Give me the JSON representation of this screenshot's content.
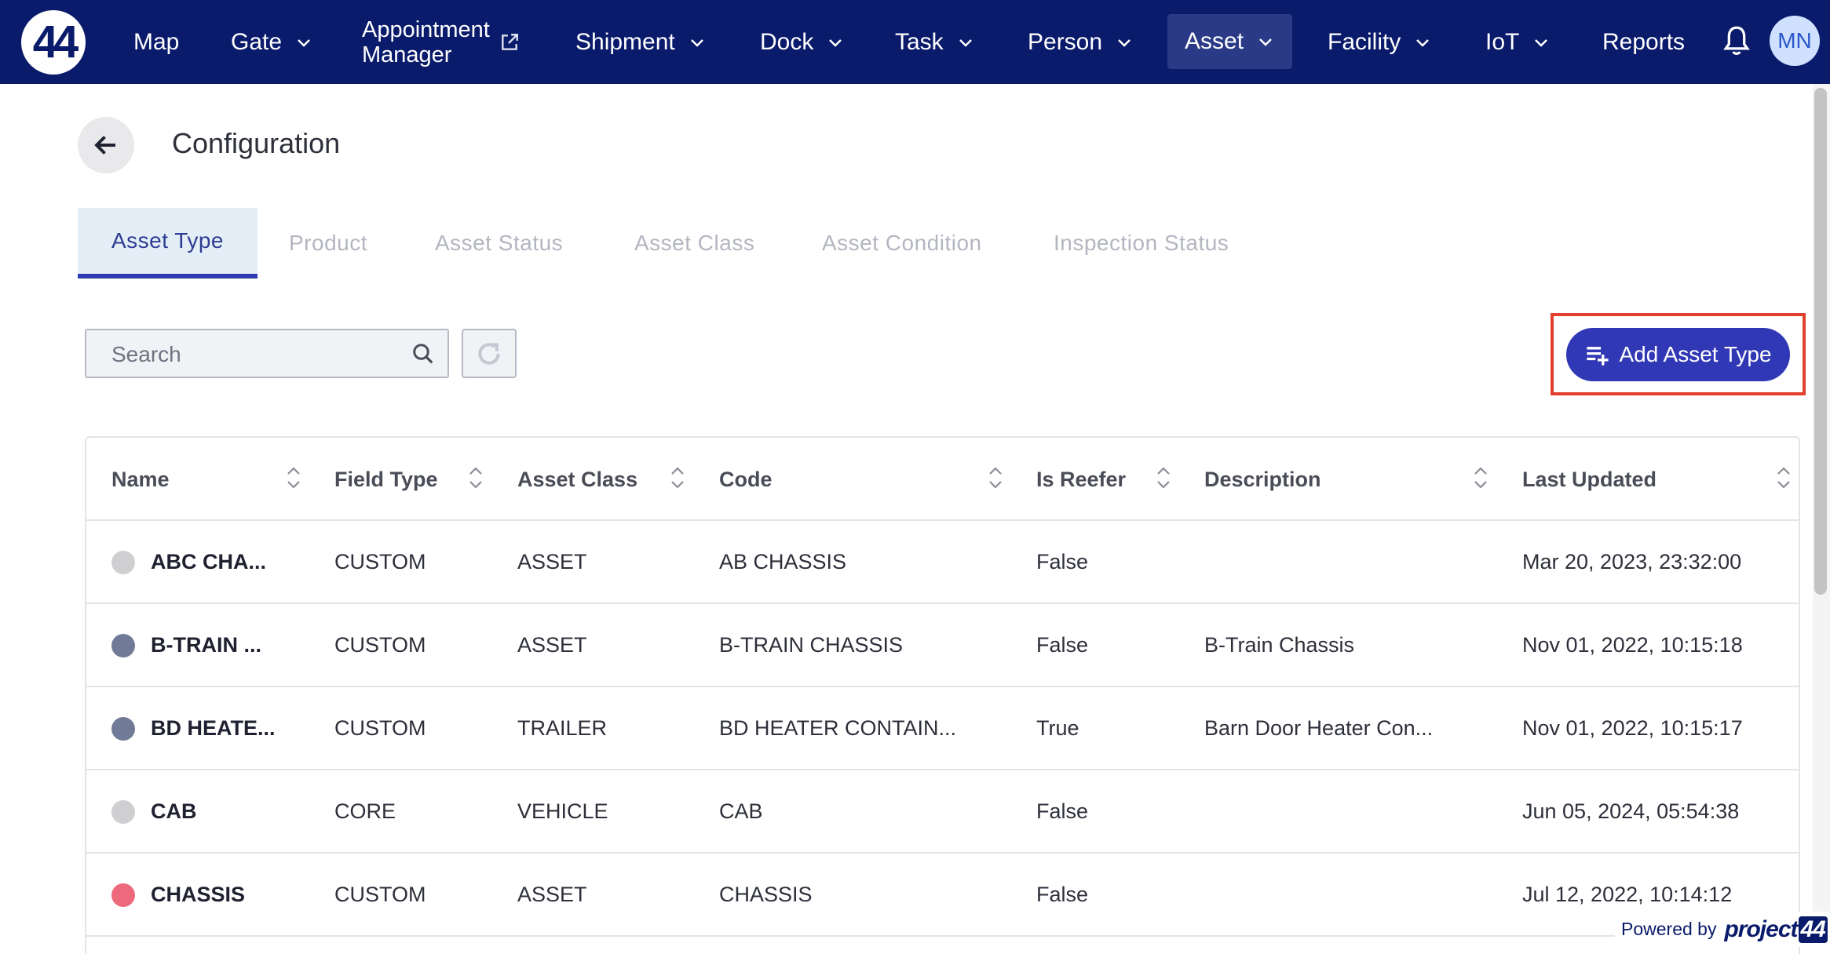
{
  "logo": {
    "text": "44"
  },
  "nav": {
    "map": "Map",
    "gate": "Gate",
    "appointment_line1": "Appointment",
    "appointment_line2": "Manager",
    "shipment": "Shipment",
    "dock": "Dock",
    "task": "Task",
    "person": "Person",
    "asset": "Asset",
    "facility": "Facility",
    "iot": "IoT",
    "reports": "Reports",
    "avatar_initials": "MN"
  },
  "header": {
    "title": "Configuration"
  },
  "tabs": [
    {
      "label": "Asset Type",
      "active": true
    },
    {
      "label": "Product",
      "active": false
    },
    {
      "label": "Asset Status",
      "active": false
    },
    {
      "label": "Asset Class",
      "active": false
    },
    {
      "label": "Asset Condition",
      "active": false
    },
    {
      "label": "Inspection Status",
      "active": false
    }
  ],
  "toolbar": {
    "search_placeholder": "Search",
    "search_value": "",
    "add_label": "Add Asset Type"
  },
  "table": {
    "columns": [
      "Name",
      "Field Type",
      "Asset Class",
      "Code",
      "Is Reefer",
      "Description",
      "Last Updated"
    ],
    "rows": [
      {
        "dot_color": "#cfcfd2",
        "name": "ABC CHA...",
        "field_type": "CUSTOM",
        "asset_class": "ASSET",
        "code": "AB CHASSIS",
        "is_reefer": "False",
        "description": "",
        "last_updated": "Mar 20, 2023, 23:32:00"
      },
      {
        "dot_color": "#717b98",
        "name": "B-TRAIN ...",
        "field_type": "CUSTOM",
        "asset_class": "ASSET",
        "code": "B-TRAIN CHASSIS",
        "is_reefer": "False",
        "description": "B-Train Chassis",
        "last_updated": "Nov 01, 2022, 10:15:18"
      },
      {
        "dot_color": "#717b98",
        "name": "BD HEATE...",
        "field_type": "CUSTOM",
        "asset_class": "TRAILER",
        "code": "BD HEATER CONTAIN...",
        "is_reefer": "True",
        "description": "Barn Door Heater Con...",
        "last_updated": "Nov 01, 2022, 10:15:17"
      },
      {
        "dot_color": "#cfcfd2",
        "name": "CAB",
        "field_type": "CORE",
        "asset_class": "VEHICLE",
        "code": "CAB",
        "is_reefer": "False",
        "description": "",
        "last_updated": "Jun 05, 2024, 05:54:38"
      },
      {
        "dot_color": "#ec6a7c",
        "name": "CHASSIS",
        "field_type": "CUSTOM",
        "asset_class": "ASSET",
        "code": "CHASSIS",
        "is_reefer": "False",
        "description": "",
        "last_updated": "Jul 12, 2022, 10:14:12"
      }
    ]
  },
  "footer": {
    "powered_by": "Powered by",
    "brand_text": "project",
    "brand_num": "44"
  },
  "colors": {
    "nav_bg": "#0a1b6b",
    "accent": "#3138b5",
    "highlight": "#e2402c"
  },
  "icons": {
    "bell": "bell-icon",
    "back": "arrow-left-icon",
    "search": "search-icon",
    "refresh": "refresh-icon",
    "add": "playlist-add-icon",
    "external": "external-link-icon",
    "sort": "sort-icon"
  }
}
